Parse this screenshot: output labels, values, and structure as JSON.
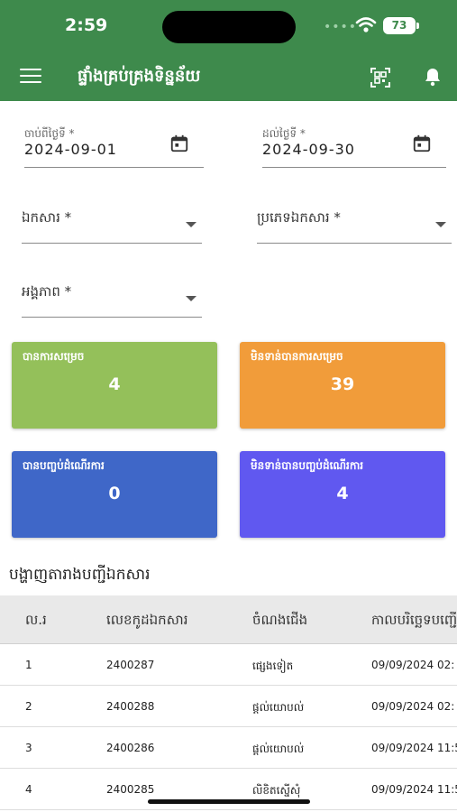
{
  "status_bar": {
    "time": "2:59",
    "battery": "73"
  },
  "app_bar": {
    "title": "ផ្ទាំងគ្រប់គ្រងទិន្នន័យ"
  },
  "filters": {
    "from_date": {
      "label": "ចាប់ពីថ្ងៃទី *",
      "value": "2024-09-01"
    },
    "to_date": {
      "label": "ដល់ថ្ងៃទី *",
      "value": "2024-09-30"
    },
    "document": {
      "label": "ឯកសារ *"
    },
    "document_type": {
      "label": "ប្រភេទឯកសារ *"
    },
    "entity": {
      "label": "អង្គភាព *"
    }
  },
  "cards": [
    {
      "label": "បានការសម្រេច",
      "value": "4",
      "color": "#94c05a"
    },
    {
      "label": "មិនទាន់បានការសម្រេច",
      "value": "39",
      "color": "#f19c3a"
    },
    {
      "label": "បានបញ្ចប់ដំណើរការ",
      "value": "0",
      "color": "#3f67c8"
    },
    {
      "label": "មិនទាន់បានបញ្ចប់ដំណើរការ",
      "value": "4",
      "color": "#6058f0"
    }
  ],
  "table": {
    "title": "បង្ហាញតារាងបញ្ជីឯកសារ",
    "headers": [
      "ល.រ",
      "លេខកូដឯកសារ",
      "ចំណងជើង",
      "កាលបរិច្ឆេទបញ្ជើ"
    ],
    "rows": [
      [
        "1",
        "2400287",
        "ផ្សេងទៀត",
        "09/09/2024 02:"
      ],
      [
        "2",
        "2400288",
        "ផ្តល់យោបល់",
        "09/09/2024 02:"
      ],
      [
        "3",
        "2400286",
        "ផ្តល់យោបល់",
        "09/09/2024 11:5"
      ],
      [
        "4",
        "2400285",
        "លិខិតស្នើសុំ",
        "09/09/2024 11:5"
      ]
    ]
  },
  "colors": {
    "primary": "#3e8a4c"
  }
}
